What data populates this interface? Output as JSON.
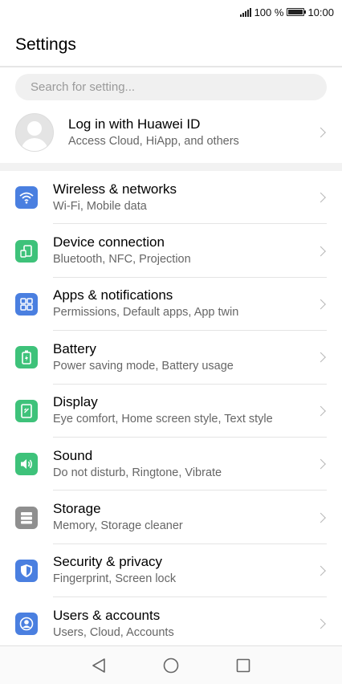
{
  "status_bar": {
    "battery_text": "100 %",
    "time": "10:00"
  },
  "header": {
    "title": "Settings"
  },
  "search": {
    "placeholder": "Search for setting..."
  },
  "account": {
    "title": "Log in with Huawei ID",
    "subtitle": "Access Cloud, HiApp, and others"
  },
  "items": [
    {
      "title": "Wireless & networks",
      "subtitle": "Wi-Fi, Mobile data",
      "icon": "wifi-icon",
      "color": "#4a7fe0"
    },
    {
      "title": "Device connection",
      "subtitle": "Bluetooth, NFC, Projection",
      "icon": "device-connection-icon",
      "color": "#3ec27a"
    },
    {
      "title": "Apps & notifications",
      "subtitle": "Permissions, Default apps, App twin",
      "icon": "apps-grid-icon",
      "color": "#4a7fe0"
    },
    {
      "title": "Battery",
      "subtitle": "Power saving mode, Battery usage",
      "icon": "battery-icon",
      "color": "#3ec27a"
    },
    {
      "title": "Display",
      "subtitle": "Eye comfort, Home screen style, Text style",
      "icon": "display-icon",
      "color": "#3ec27a"
    },
    {
      "title": "Sound",
      "subtitle": "Do not disturb, Ringtone, Vibrate",
      "icon": "speaker-icon",
      "color": "#3ec27a"
    },
    {
      "title": "Storage",
      "subtitle": "Memory, Storage cleaner",
      "icon": "storage-icon",
      "color": "#8f8f8f"
    },
    {
      "title": "Security & privacy",
      "subtitle": "Fingerprint, Screen lock",
      "icon": "shield-icon",
      "color": "#4a7fe0"
    },
    {
      "title": "Users & accounts",
      "subtitle": "Users, Cloud, Accounts",
      "icon": "user-icon",
      "color": "#4a7fe0"
    }
  ],
  "nav": [
    "back-icon",
    "home-icon",
    "recents-icon"
  ]
}
